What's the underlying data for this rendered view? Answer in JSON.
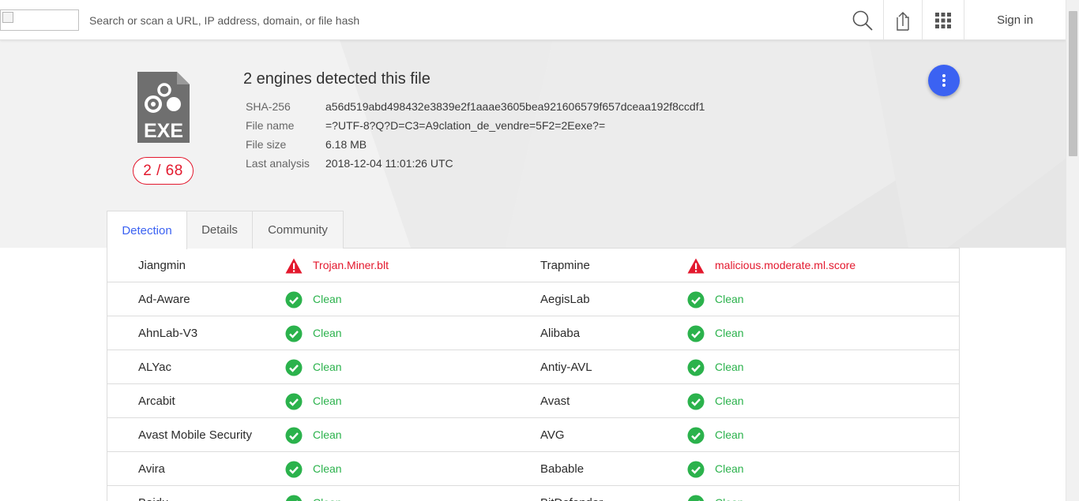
{
  "search": {
    "placeholder": "Search or scan a URL, IP address, domain, or file hash"
  },
  "header": {
    "sign_in_label": "Sign in"
  },
  "file": {
    "icon_label": "EXE",
    "score": "2 / 68",
    "headline": "2 engines detected this file",
    "details": [
      {
        "label": "SHA-256",
        "value": "a56d519abd498432e3839e2f1aaae3605bea921606579f657dceaa192f8ccdf1"
      },
      {
        "label": "File name",
        "value": "=?UTF-8?Q?D=C3=A9clation_de_vendre=5F2=2Eexe?="
      },
      {
        "label": "File size",
        "value": "6.18 MB"
      },
      {
        "label": "Last analysis",
        "value": "2018-12-04 11:01:26 UTC"
      }
    ]
  },
  "tabs": [
    {
      "label": "Detection",
      "active": true
    },
    {
      "label": "Details",
      "active": false
    },
    {
      "label": "Community",
      "active": false
    }
  ],
  "colors": {
    "accent": "#3b62f2",
    "malicious": "#e3182d",
    "clean": "#2bb24c"
  },
  "detections": [
    {
      "left": {
        "engine": "Jiangmin",
        "result": "Trojan.Miner.blt",
        "status": "malicious"
      },
      "right": {
        "engine": "Trapmine",
        "result": "malicious.moderate.ml.score",
        "status": "malicious"
      }
    },
    {
      "left": {
        "engine": "Ad-Aware",
        "result": "Clean",
        "status": "clean"
      },
      "right": {
        "engine": "AegisLab",
        "result": "Clean",
        "status": "clean"
      }
    },
    {
      "left": {
        "engine": "AhnLab-V3",
        "result": "Clean",
        "status": "clean"
      },
      "right": {
        "engine": "Alibaba",
        "result": "Clean",
        "status": "clean"
      }
    },
    {
      "left": {
        "engine": "ALYac",
        "result": "Clean",
        "status": "clean"
      },
      "right": {
        "engine": "Antiy-AVL",
        "result": "Clean",
        "status": "clean"
      }
    },
    {
      "left": {
        "engine": "Arcabit",
        "result": "Clean",
        "status": "clean"
      },
      "right": {
        "engine": "Avast",
        "result": "Clean",
        "status": "clean"
      }
    },
    {
      "left": {
        "engine": "Avast Mobile Security",
        "result": "Clean",
        "status": "clean"
      },
      "right": {
        "engine": "AVG",
        "result": "Clean",
        "status": "clean"
      }
    },
    {
      "left": {
        "engine": "Avira",
        "result": "Clean",
        "status": "clean"
      },
      "right": {
        "engine": "Babable",
        "result": "Clean",
        "status": "clean"
      }
    },
    {
      "left": {
        "engine": "Baidu",
        "result": "Clean",
        "status": "clean"
      },
      "right": {
        "engine": "BitDefender",
        "result": "Clean",
        "status": "clean"
      }
    }
  ]
}
